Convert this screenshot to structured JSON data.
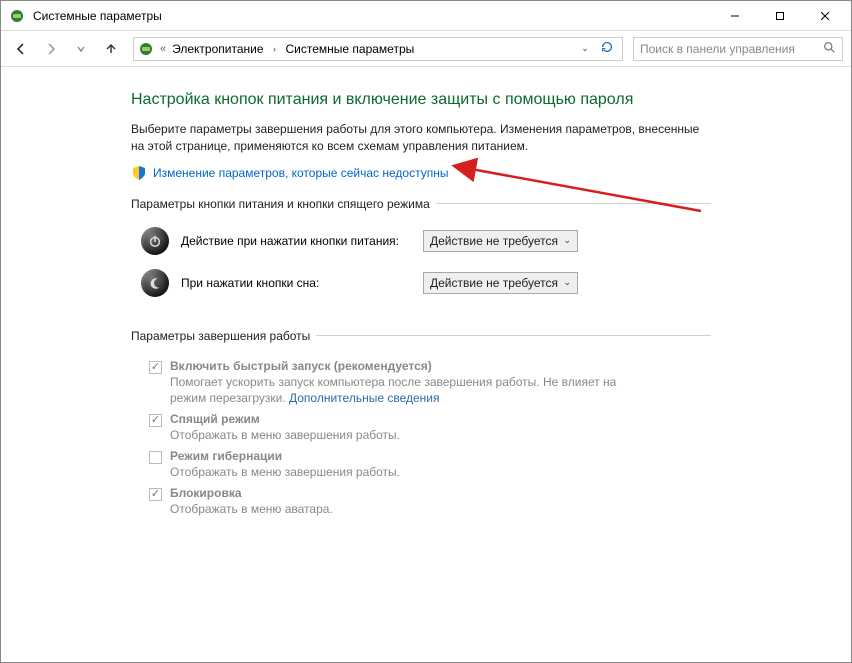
{
  "window": {
    "title": "Системные параметры"
  },
  "breadcrumb": {
    "item1": "Электропитание",
    "item2": "Системные параметры"
  },
  "search": {
    "placeholder": "Поиск в панели управления"
  },
  "heading": "Настройка кнопок питания и включение защиты с помощью пароля",
  "description": "Выберите параметры завершения работы для этого компьютера. Изменения параметров, внесенные на этой странице, применяются ко всем схемам управления питанием.",
  "change_unavailable_link": "Изменение параметров, которые сейчас недоступны",
  "group1": {
    "legend": "Параметры кнопки питания и кнопки спящего режима",
    "power_button_label": "Действие при нажатии кнопки питания:",
    "power_button_value": "Действие не требуется",
    "sleep_button_label": "При нажатии кнопки сна:",
    "sleep_button_value": "Действие не требуется"
  },
  "group2": {
    "legend": "Параметры завершения работы",
    "items": [
      {
        "checked": true,
        "label": "Включить быстрый запуск (рекомендуется)",
        "sub_pre": "Помогает ускорить запуск компьютера после завершения работы. Не влияет на режим перезагрузки. ",
        "sub_link": "Дополнительные сведения"
      },
      {
        "checked": true,
        "label": "Спящий режим",
        "sub": "Отображать в меню завершения работы."
      },
      {
        "checked": false,
        "label": "Режим гибернации",
        "sub": "Отображать в меню завершения работы."
      },
      {
        "checked": true,
        "label": "Блокировка",
        "sub": "Отображать в меню аватара."
      }
    ]
  }
}
